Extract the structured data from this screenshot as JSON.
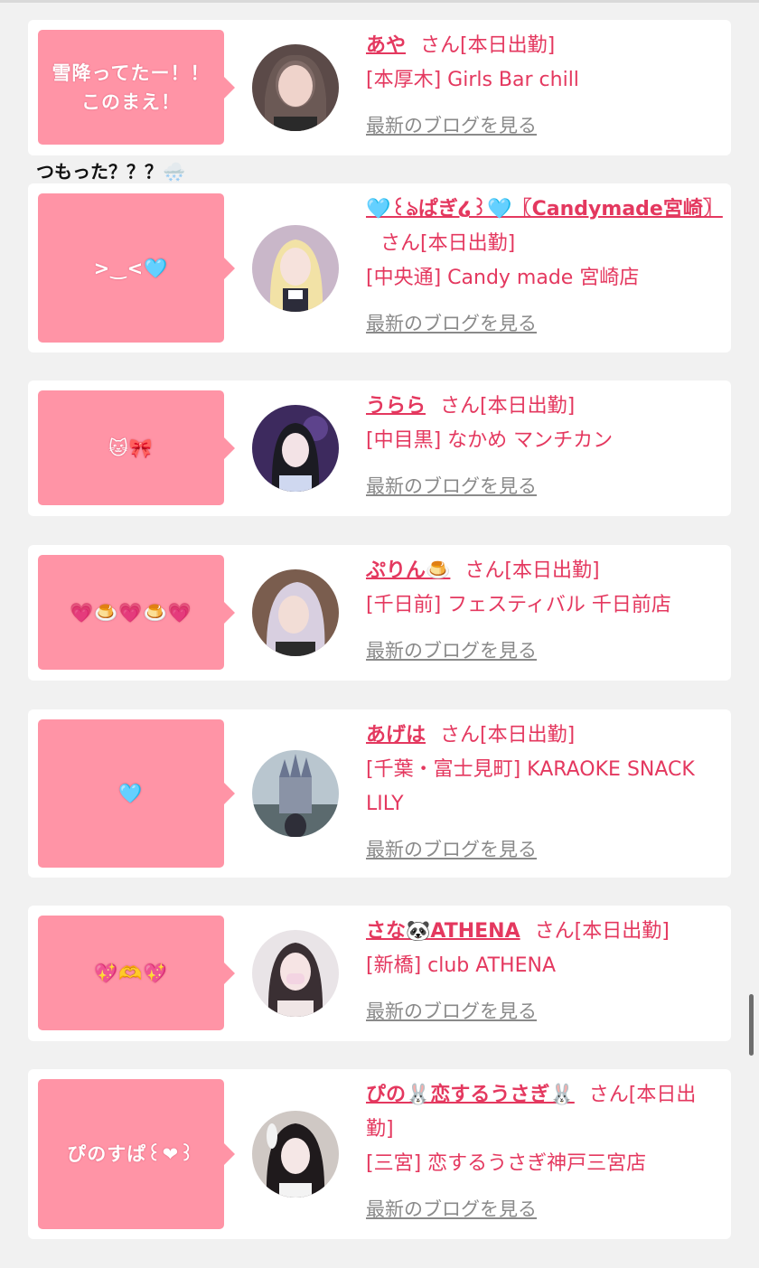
{
  "comment_after_first": "つもった？？？🌨️",
  "san_label": "さん[本日出勤]",
  "blog_link": "最新のブログを見る",
  "colors": {
    "bubble": "#ff94a6",
    "name": "#e4385f",
    "link": "#8a8a8a",
    "background": "#f1f1f1"
  },
  "cards": [
    {
      "bubble": "雪降ってたー！！\nこのまえ！",
      "name": "あや",
      "san": "さん[本日出勤]",
      "shop": "[本厚木] Girls Bar chill",
      "blog": "最新のブログを見る"
    },
    {
      "bubble": ">‿<🩵",
      "name": "🩵꒰ঌぱぎ໒꒱🩵〖Candymade宮崎〗",
      "san": "さん[本日出勤]",
      "shop": "[中央通] Candy made 宮崎店",
      "blog": "最新のブログを見る"
    },
    {
      "bubble": "🐱🎀",
      "name": "うらら",
      "san": "さん[本日出勤]",
      "shop": "[中目黒] なかめ マンチカン",
      "blog": "最新のブログを見る"
    },
    {
      "bubble": "💗🍮💗🍮💗",
      "name": "ぷりん🍮",
      "san": "さん[本日出勤]",
      "shop": "[千日前] フェスティバル 千日前店",
      "blog": "最新のブログを見る"
    },
    {
      "bubble": "🩵",
      "name": "あげは",
      "san": "さん[本日出勤]",
      "shop": "[千葉・富士見町] KARAOKE SNACK LILY",
      "blog": "最新のブログを見る"
    },
    {
      "bubble": "💖🫶💖",
      "name": "さな🐼ATHENA",
      "san": "さん[本日出勤]",
      "shop": "[新橋] club ATHENA",
      "blog": "最新のブログを見る"
    },
    {
      "bubble": "ぴのすぱ꒰❤︎꒱",
      "name": "ぴの🐰恋するうさぎ🐰",
      "san": "さん[本日出勤]",
      "shop": "[三宮] 恋するうさぎ神戸三宮店",
      "blog": "最新のブログを見る"
    }
  ]
}
